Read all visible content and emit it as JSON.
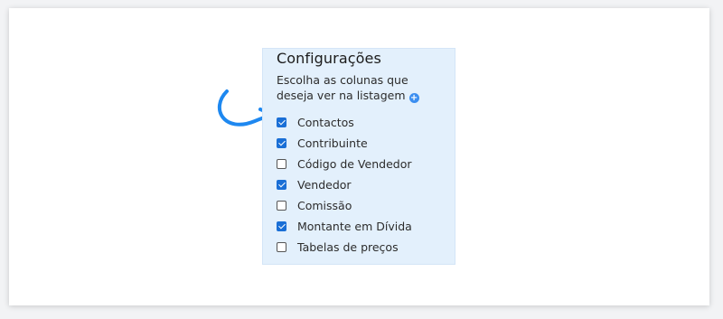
{
  "settings": {
    "title": "Configurações",
    "description": "Escolha as colunas que deseja ver na listagem",
    "add_icon": "plus-circle-icon",
    "options": [
      {
        "label": "Contactos",
        "checked": true
      },
      {
        "label": "Contribuinte",
        "checked": true
      },
      {
        "label": "Código de Vendedor",
        "checked": false
      },
      {
        "label": "Vendedor",
        "checked": true
      },
      {
        "label": "Comissão",
        "checked": false
      },
      {
        "label": "Montante em Dívida",
        "checked": true
      },
      {
        "label": "Tabelas de preços",
        "checked": false
      }
    ]
  },
  "annotation": {
    "icon": "curved-arrow-icon",
    "color": "#1e88f0"
  },
  "colors": {
    "panel_bg": "#e3f0fc",
    "checkbox_checked": "#1a6fd6",
    "add_icon": "#3b8ef0"
  }
}
